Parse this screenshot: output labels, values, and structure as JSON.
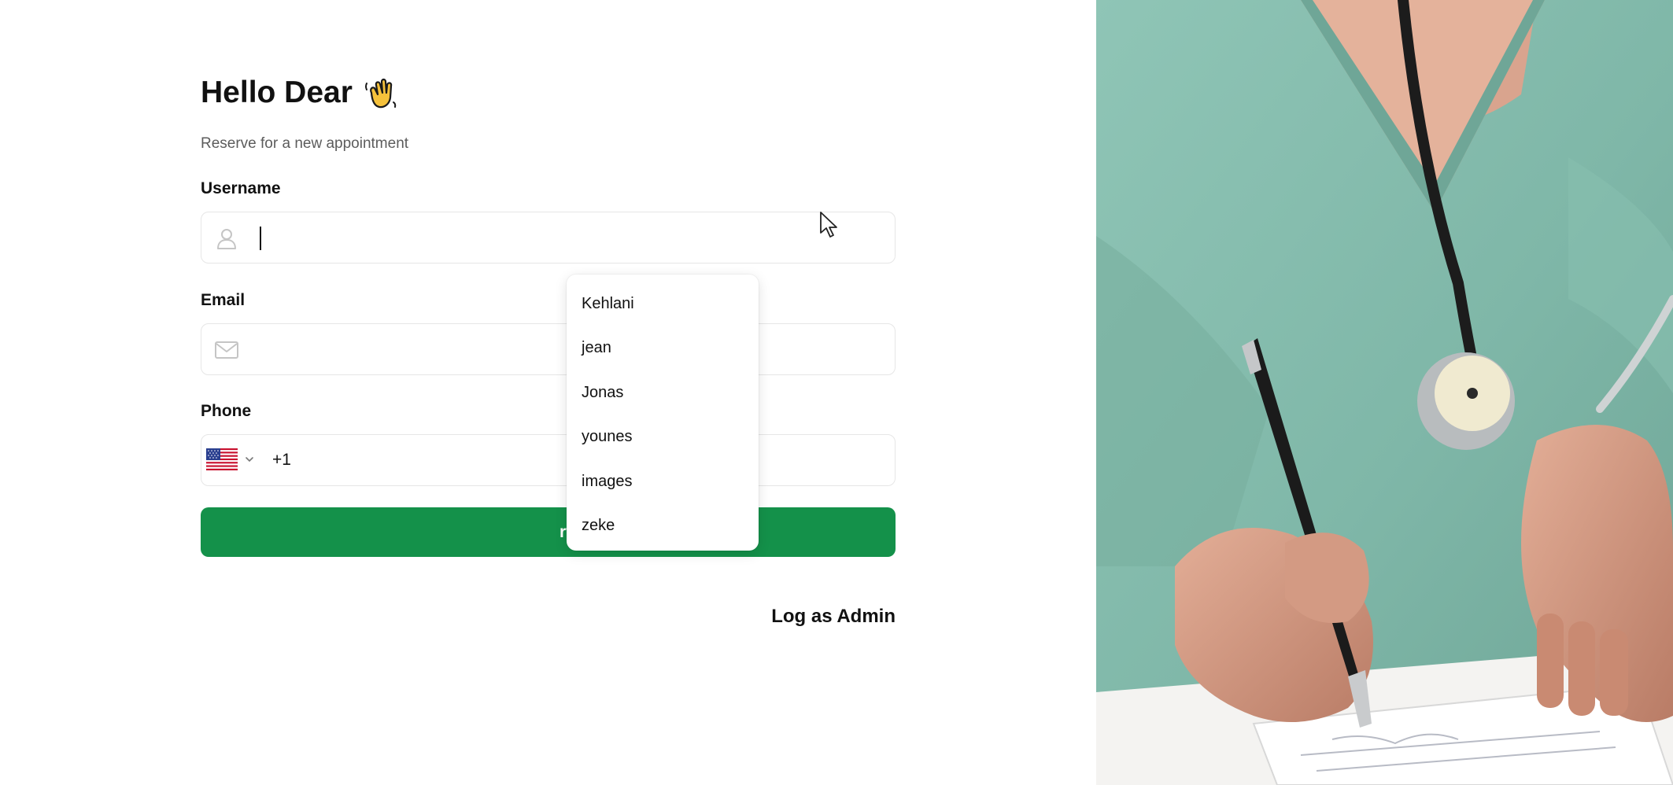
{
  "greeting": {
    "title": "Hello Dear",
    "subtitle": "Reserve for a new appointment"
  },
  "form": {
    "username": {
      "label": "Username",
      "value": "",
      "icon": "user-icon"
    },
    "email": {
      "label": "Email",
      "value": "",
      "icon": "mail-icon"
    },
    "phone": {
      "label": "Phone",
      "country_flag": "us-flag-icon",
      "dial_code": "+1",
      "value": ""
    },
    "submit_label": "Get Started",
    "submit_visible_text": "rted"
  },
  "username_suggestions": [
    "Kehlani",
    "jean",
    "Jonas",
    "younes",
    "images",
    "zeke"
  ],
  "admin_link": "Log as Admin",
  "colors": {
    "accent": "#14914a",
    "border": "#e6e6e6",
    "scrub": "#8ec4b5"
  }
}
